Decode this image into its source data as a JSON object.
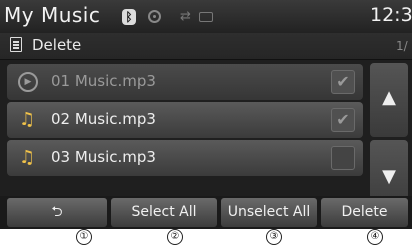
{
  "status_bar": {
    "title": "My Music",
    "clock": "12:3",
    "icons": [
      "bluetooth-icon",
      "disc-icon",
      "usb-icon",
      "battery-icon"
    ]
  },
  "subheader": {
    "label": "Delete",
    "page": "1/"
  },
  "list": {
    "items": [
      {
        "name": "01 Music.mp3",
        "icon": "play-circle-icon",
        "checked": true,
        "dimmed": true
      },
      {
        "name": "02 Music.mp3",
        "icon": "music-note-icon",
        "checked": true,
        "dimmed": false
      },
      {
        "name": "03 Music.mp3",
        "icon": "music-note-icon",
        "checked": false,
        "dimmed": false
      }
    ]
  },
  "scroll": {
    "up_symbol": "▲",
    "down_symbol": "▼"
  },
  "bottom_bar": {
    "back_symbol": "⮌",
    "select_all": "Select All",
    "unselect_all": "Unselect All",
    "delete": "Delete"
  },
  "callouts": [
    "①",
    "②",
    "③",
    "④"
  ],
  "colors": {
    "background": "#1f1f1f",
    "note_icon": "#f0c24a"
  }
}
